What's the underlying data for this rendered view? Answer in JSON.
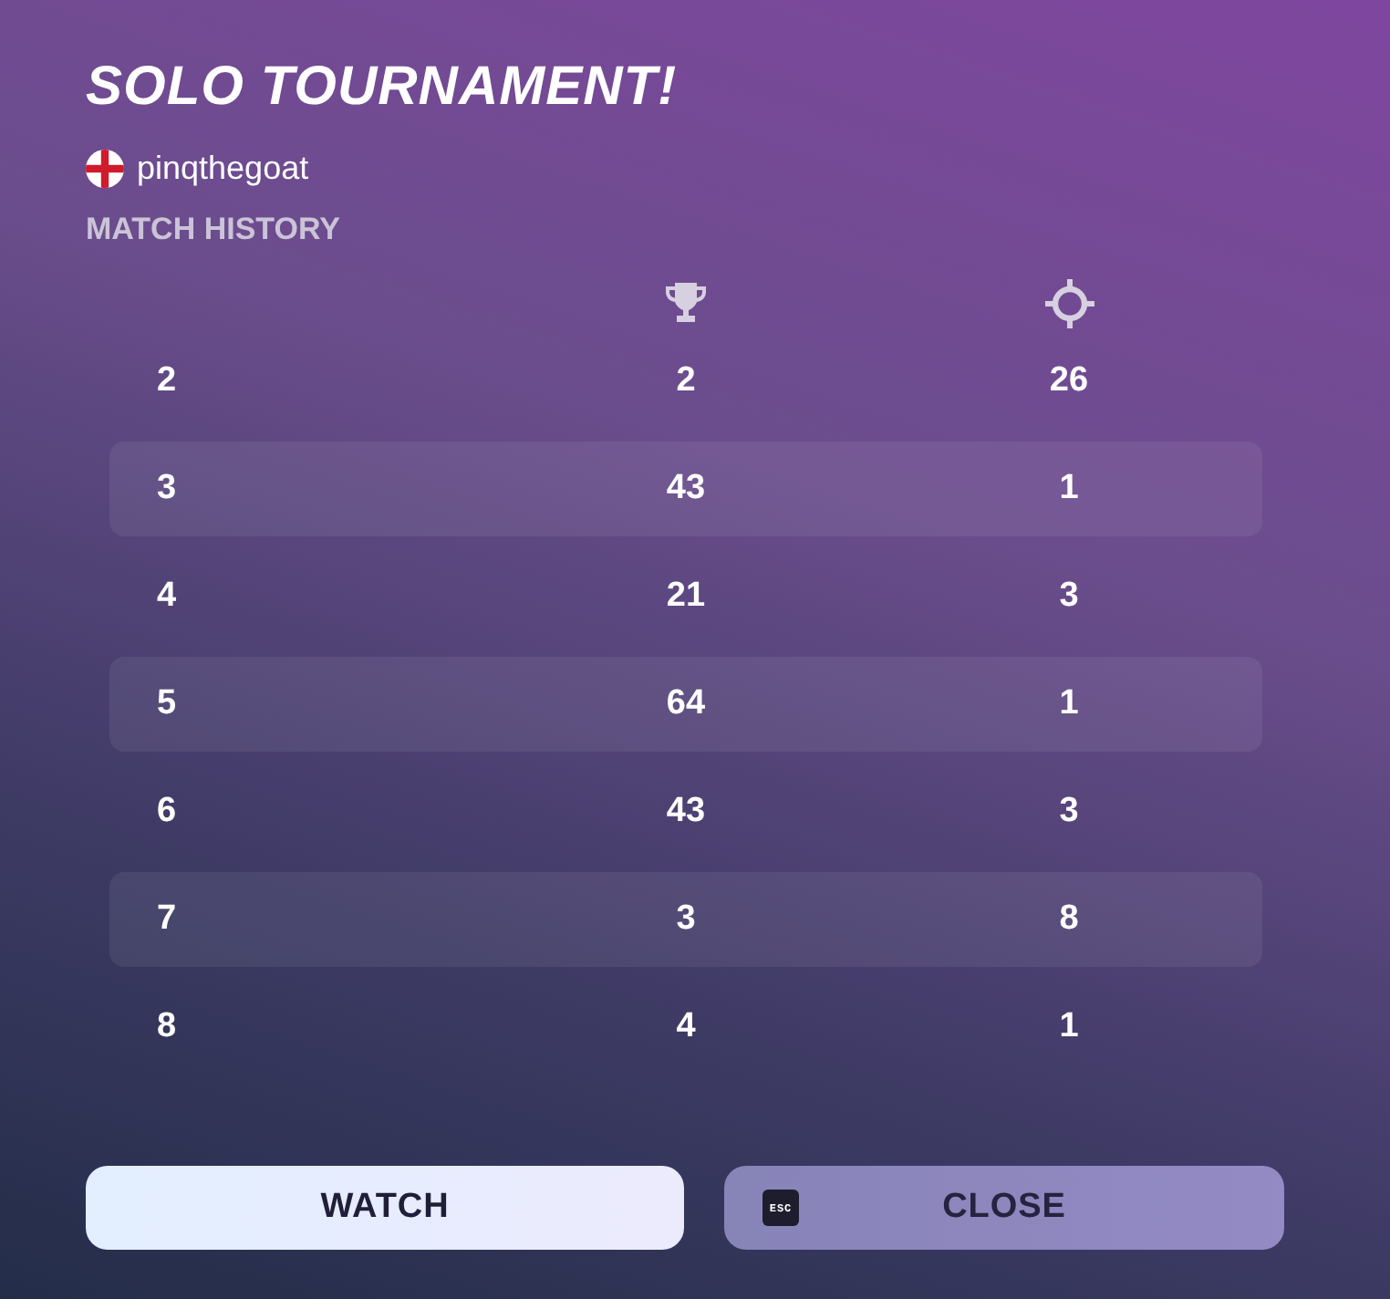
{
  "title": "SOLO TOURNAMENT!",
  "player": {
    "name": "pinqthegoat"
  },
  "match_history": {
    "heading": "MATCH HISTORY",
    "rows": [
      {
        "cells": [
          "2",
          "2",
          "26"
        ]
      },
      {
        "cells": [
          "3",
          "43",
          "1"
        ]
      },
      {
        "cells": [
          "4",
          "21",
          "3"
        ]
      },
      {
        "cells": [
          "5",
          "64",
          "1"
        ]
      },
      {
        "cells": [
          "6",
          "43",
          "3"
        ]
      },
      {
        "cells": [
          "7",
          "3",
          "8"
        ]
      },
      {
        "cells": [
          "8",
          "4",
          "1"
        ]
      }
    ]
  },
  "buttons": [
    {
      "kind": "primary",
      "label": "WATCH"
    },
    {
      "kind": "secondary",
      "label": "CLOSE",
      "key": "ESC"
    }
  ]
}
